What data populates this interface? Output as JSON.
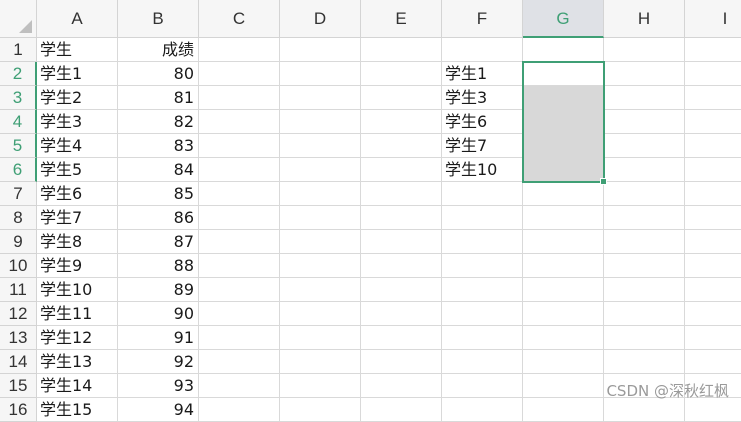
{
  "columns": [
    "A",
    "B",
    "C",
    "D",
    "E",
    "F",
    "G",
    "H",
    "I"
  ],
  "active_column": "G",
  "rows": [
    "1",
    "2",
    "3",
    "4",
    "5",
    "6",
    "7",
    "8",
    "9",
    "10",
    "11",
    "12",
    "13",
    "14",
    "15",
    "16"
  ],
  "active_rows": [
    "2",
    "3",
    "4",
    "5",
    "6"
  ],
  "cells": {
    "A1": "学生",
    "B1": "成绩",
    "A2": "学生1",
    "B2": "80",
    "A3": "学生2",
    "B3": "81",
    "A4": "学生3",
    "B4": "82",
    "A5": "学生4",
    "B5": "83",
    "A6": "学生5",
    "B6": "84",
    "A7": "学生6",
    "B7": "85",
    "A8": "学生7",
    "B8": "86",
    "A9": "学生8",
    "B9": "87",
    "A10": "学生9",
    "B10": "88",
    "A11": "学生10",
    "B11": "89",
    "A12": "学生11",
    "B12": "90",
    "A13": "学生12",
    "B13": "91",
    "A14": "学生13",
    "B14": "92",
    "A15": "学生14",
    "B15": "93",
    "A16": "学生15",
    "B16": "94",
    "F2": "学生1",
    "F3": "学生3",
    "F4": "学生6",
    "F5": "学生7",
    "F6": "学生10"
  },
  "selection": "G2:G6",
  "colors": {
    "accent": "#3f9f75",
    "selection_fill": "#d8d8d8",
    "header_bg": "#f6f6f6"
  },
  "watermark": "CSDN @深秋红枫"
}
